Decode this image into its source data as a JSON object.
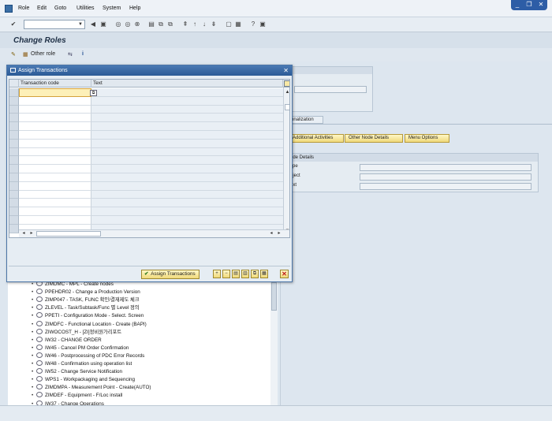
{
  "menubar": {
    "items": [
      "Role",
      "Edit",
      "Goto",
      "Utilities",
      "System",
      "Help"
    ]
  },
  "window_controls": [
    "_",
    "❐",
    "✕"
  ],
  "toolbar": {
    "command_field_value": ""
  },
  "page": {
    "title": "Change Roles"
  },
  "app_toolbar": {
    "other_role_label": "Other role"
  },
  "background": {
    "tab_label": "onalization",
    "buttons": [
      "Additional Activities",
      "Other Node Details",
      "Menu Options"
    ],
    "node_details_title": "ode Details",
    "node_fields": [
      "ype",
      "bject",
      "ext"
    ]
  },
  "dialog": {
    "title": "Assign Transactions",
    "columns": [
      "Transaction code",
      "Text"
    ],
    "assign_button_label": "Assign Transactions"
  },
  "tree": {
    "items": [
      "ZIMDMC - MPL - Create nodes",
      "PPEHDR02 - Change a Production Version",
      "ZIMP047 - TASK, FUNC 확인/결재제도 체크",
      "ZLEVEL - Task/Subtask/Func 별 Level 정의",
      "PPETI - Configuration Mode - Select. Screen",
      "ZIMDFC - Functional Location - Create (BAPI)",
      "ZIWOCOST_H - [ZI]정비원가리포트",
      "IW32 - CHANGE ORDER",
      "IW45 - Cancel PM Order Confirmation",
      "IW46 - Postprocessing of PDC Error Records",
      "IW48 - Confirmation using operation list",
      "IW52 - Change Service Notification",
      "WPS1 - Workpackaging and Sequencing",
      "ZIMDMPA - Measurement Point - Create(AUTO)",
      "ZIMDEF - Equipment - F/Loc install",
      "IW37 - Change Operations"
    ]
  }
}
